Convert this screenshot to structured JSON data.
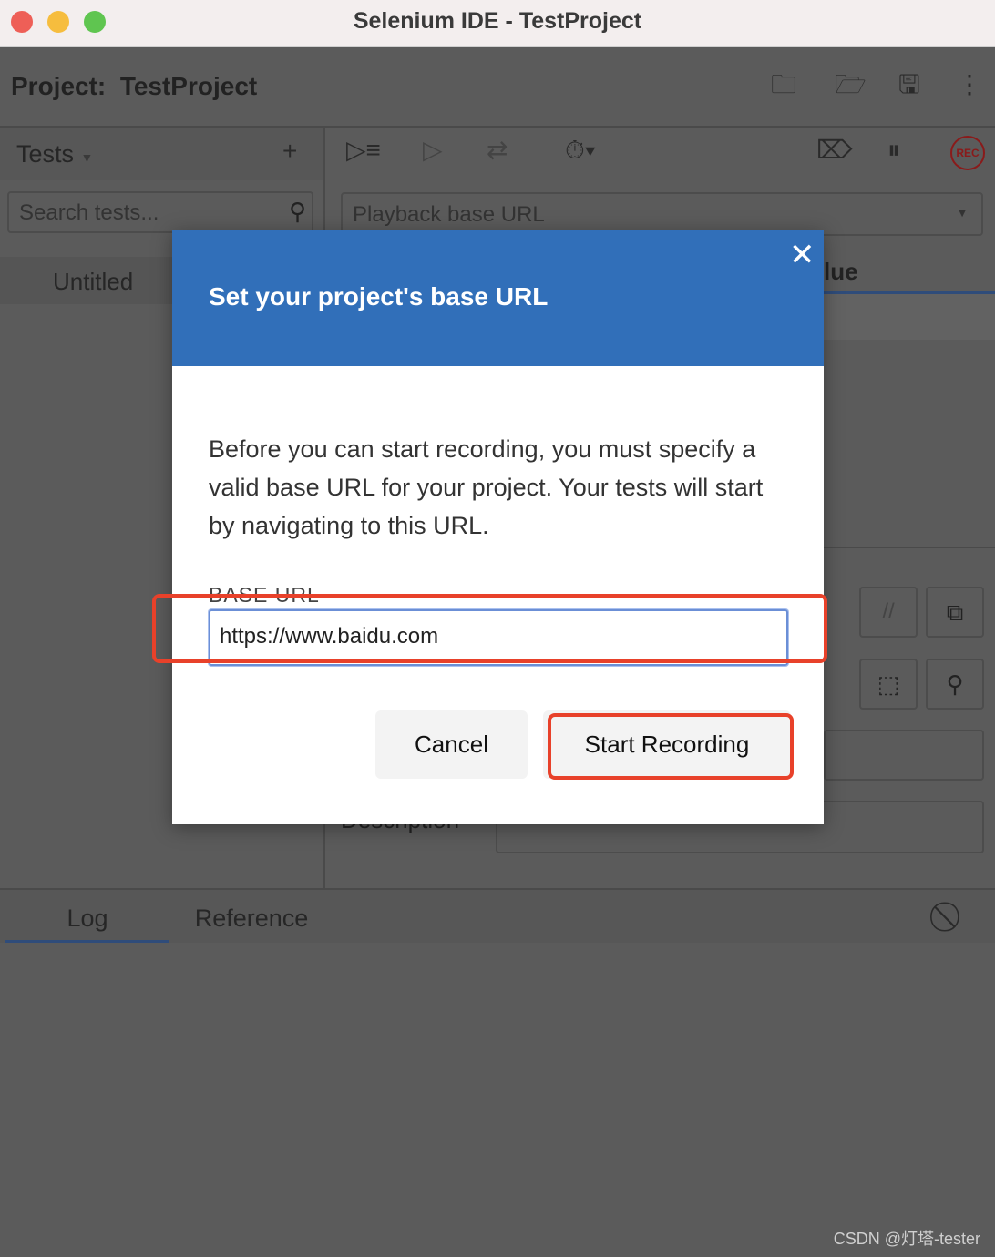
{
  "window": {
    "title": "Selenium IDE - TestProject"
  },
  "project": {
    "label": "Project:",
    "name": "TestProject"
  },
  "tests_panel": {
    "title": "Tests",
    "search_placeholder": "Search tests...",
    "items": [
      {
        "label": "Untitled"
      }
    ]
  },
  "editor": {
    "base_url_placeholder": "Playback base URL",
    "column_value_partial": "lue",
    "description_label": "Description"
  },
  "bottom": {
    "tabs": [
      {
        "label": "Log",
        "active": true
      },
      {
        "label": "Reference",
        "active": false
      }
    ]
  },
  "dialog": {
    "title": "Set your project's base URL",
    "body": "Before you can start recording, you must specify a valid base URL for your project. Your tests will start by navigating to this URL.",
    "field_label": "BASE URL",
    "field_value": "https://www.baidu.com",
    "cancel_label": "Cancel",
    "start_label": "Start Recording",
    "header_color": "#316fb9",
    "highlight_color": "#e8412a"
  },
  "rec_label": "REC",
  "watermark": "CSDN @灯塔-tester"
}
